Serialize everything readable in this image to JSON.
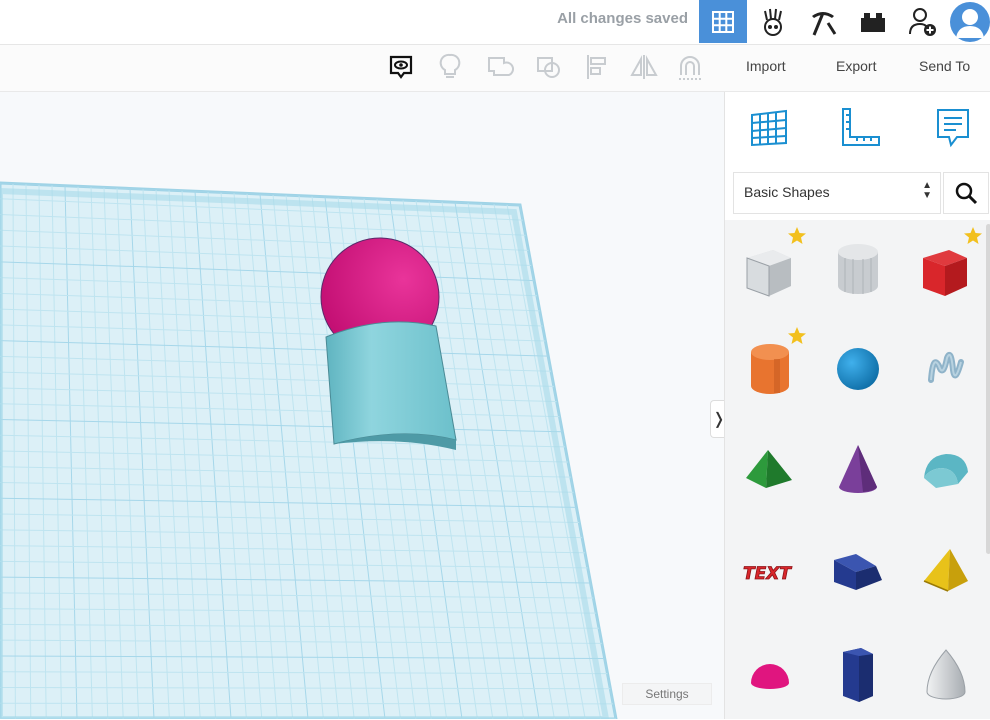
{
  "topbar": {
    "save_status": "All changes saved",
    "buttons": [
      {
        "name": "3d-design-view",
        "icon": "grid-view-icon",
        "active": true
      },
      {
        "name": "blocks-view",
        "icon": "hand-blocks-icon",
        "active": false
      },
      {
        "name": "bricks-view",
        "icon": "pickaxe-icon",
        "active": false
      },
      {
        "name": "lego-view",
        "icon": "brick-icon",
        "active": false
      },
      {
        "name": "invite-user",
        "icon": "add-user-icon",
        "active": false
      },
      {
        "name": "user-avatar",
        "icon": "avatar-icon",
        "active": false
      }
    ],
    "accent": "#4a90d9"
  },
  "toolbar": {
    "tools": [
      "notes-icon",
      "lightbulb-icon",
      "group-icon",
      "ungroup-icon",
      "align-icon",
      "mirror-icon",
      "magnet-icon"
    ],
    "import_label": "Import",
    "export_label": "Export",
    "send_to_label": "Send To"
  },
  "workplane": {
    "grid_color": "#bfe4f0",
    "settings_label": "Settings",
    "collapse_glyph": "❭"
  },
  "panel": {
    "icons": [
      "workplane-icon",
      "ruler-icon",
      "notes-panel-icon"
    ],
    "category": "Basic Shapes",
    "shapes": [
      {
        "name": "box-hole",
        "color": "#c8ccd0",
        "starred": true
      },
      {
        "name": "cylinder-hole",
        "color": "#c8ccd0",
        "starred": false
      },
      {
        "name": "box",
        "color": "#d9262b",
        "starred": true
      },
      {
        "name": "cylinder",
        "color": "#e8742f",
        "starred": true
      },
      {
        "name": "sphere",
        "color": "#1a8fd1",
        "starred": false
      },
      {
        "name": "scribble",
        "color": "#8fb3c9",
        "starred": false
      },
      {
        "name": "pyramid",
        "color": "#2d9a3c",
        "starred": false
      },
      {
        "name": "cone",
        "color": "#7a3f9a",
        "starred": false
      },
      {
        "name": "roof",
        "color": "#5bb6c4",
        "starred": false
      },
      {
        "name": "text",
        "color": "#d9262b",
        "starred": false
      },
      {
        "name": "wedge",
        "color": "#243a8f",
        "starred": false
      },
      {
        "name": "pyramid-yellow",
        "color": "#e8c21a",
        "starred": false
      },
      {
        "name": "half-sphere",
        "color": "#e0157f",
        "starred": false
      },
      {
        "name": "polygon",
        "color": "#243a8f",
        "starred": false
      },
      {
        "name": "paraboloid",
        "color": "#d8dadc",
        "starred": false
      }
    ]
  },
  "scene": {
    "sphere_color": "#d8157f",
    "cylinder_color": "#7cc9d3"
  }
}
